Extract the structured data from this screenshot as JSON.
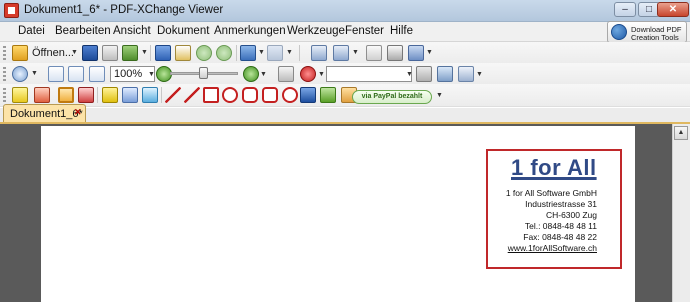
{
  "window": {
    "title": "Dokument1_6* - PDF-XChange Viewer",
    "minimize_glyph": "–",
    "maximize_glyph": "□",
    "close_glyph": "✕"
  },
  "menu": {
    "items": [
      "Datei",
      "Bearbeiten",
      "Ansicht",
      "Dokument",
      "Anmerkungen",
      "Werkzeuge",
      "Fenster",
      "Hilfe"
    ]
  },
  "promo": {
    "line1": "Download PDF",
    "line2": "Creation Tools"
  },
  "toolbar1": {
    "open_label": "Öffnen..."
  },
  "toolbar2": {
    "zoom_value": "100%",
    "search_value": ""
  },
  "toolbar3": {
    "paypal_label": "via PayPal bezahlt"
  },
  "tabs": [
    {
      "label": "Dokument1_6*",
      "close_glyph": "✕"
    }
  ],
  "document": {
    "logo_text": "1 for All",
    "address_lines": [
      "1 for All Software GmbH",
      "Industriestrasse 31",
      "CH-6300 Zug",
      "Tel.: 0848-48 48 11",
      "Fax: 0848-48 48 22",
      "www.1forAllSoftware.ch"
    ]
  },
  "colors": {
    "logo": "#304a86",
    "letterhead_border": "#c0282a",
    "workspace": "#5a5a5a",
    "tab_active": "#fce3a8"
  }
}
